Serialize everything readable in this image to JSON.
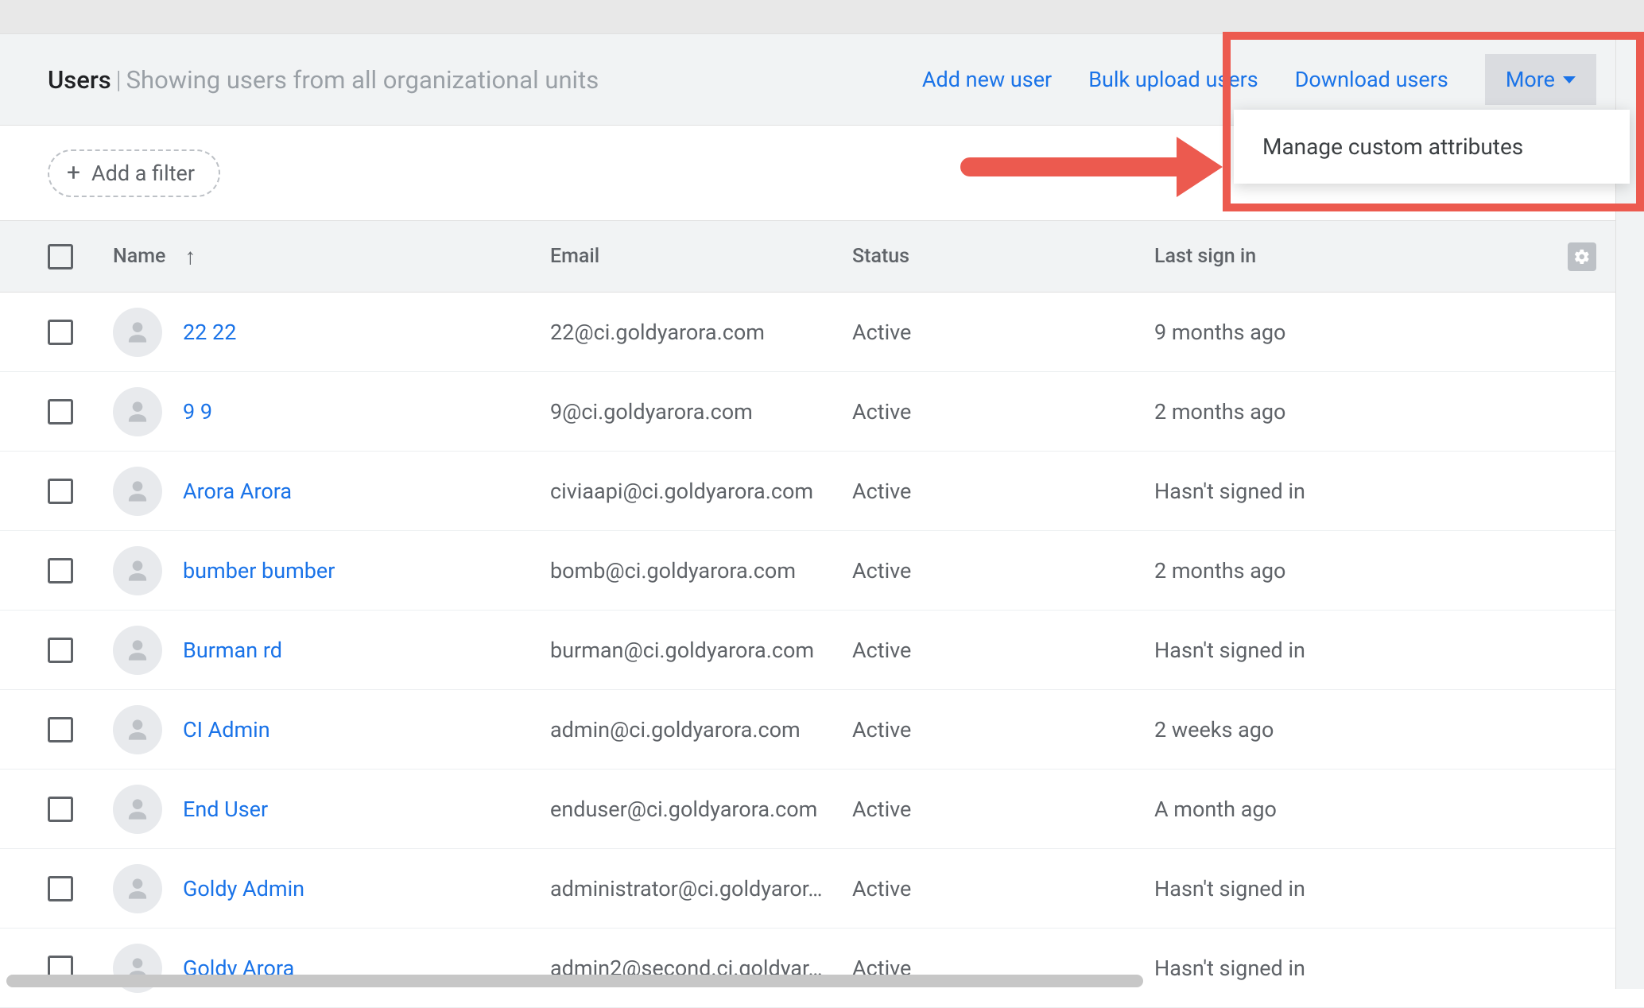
{
  "header": {
    "title": "Users",
    "separator": "|",
    "subtitle": "Showing users from all organizational units",
    "actions": {
      "add_user": "Add new user",
      "bulk_upload": "Bulk upload users",
      "download": "Download users",
      "more": "More"
    }
  },
  "filter": {
    "add_filter": "Add a filter"
  },
  "dropdown": {
    "manage_custom_attributes": "Manage custom attributes"
  },
  "table": {
    "columns": {
      "name": "Name",
      "email": "Email",
      "status": "Status",
      "last_sign_in": "Last sign in"
    },
    "sort_direction": "asc",
    "rows": [
      {
        "name": "22 22",
        "email": "22@ci.goldyarora.com",
        "status": "Active",
        "last_sign_in": "9 months ago"
      },
      {
        "name": "9 9",
        "email": "9@ci.goldyarora.com",
        "status": "Active",
        "last_sign_in": "2 months ago"
      },
      {
        "name": "Arora Arora",
        "email": "civiaapi@ci.goldyarora.com",
        "status": "Active",
        "last_sign_in": "Hasn't signed in"
      },
      {
        "name": "bumber bumber",
        "email": "bomb@ci.goldyarora.com",
        "status": "Active",
        "last_sign_in": "2 months ago"
      },
      {
        "name": "Burman rd",
        "email": "burman@ci.goldyarora.com",
        "status": "Active",
        "last_sign_in": "Hasn't signed in"
      },
      {
        "name": "CI Admin",
        "email": "admin@ci.goldyarora.com",
        "status": "Active",
        "last_sign_in": "2 weeks ago"
      },
      {
        "name": "End User",
        "email": "enduser@ci.goldyarora.com",
        "status": "Active",
        "last_sign_in": "A month ago"
      },
      {
        "name": "Goldy Admin",
        "email": "administrator@ci.goldyaror…",
        "status": "Active",
        "last_sign_in": "Hasn't signed in"
      },
      {
        "name": "Goldy Arora",
        "email": "admin2@second.ci.goldyar…",
        "status": "Active",
        "last_sign_in": "Hasn't signed in"
      }
    ]
  }
}
